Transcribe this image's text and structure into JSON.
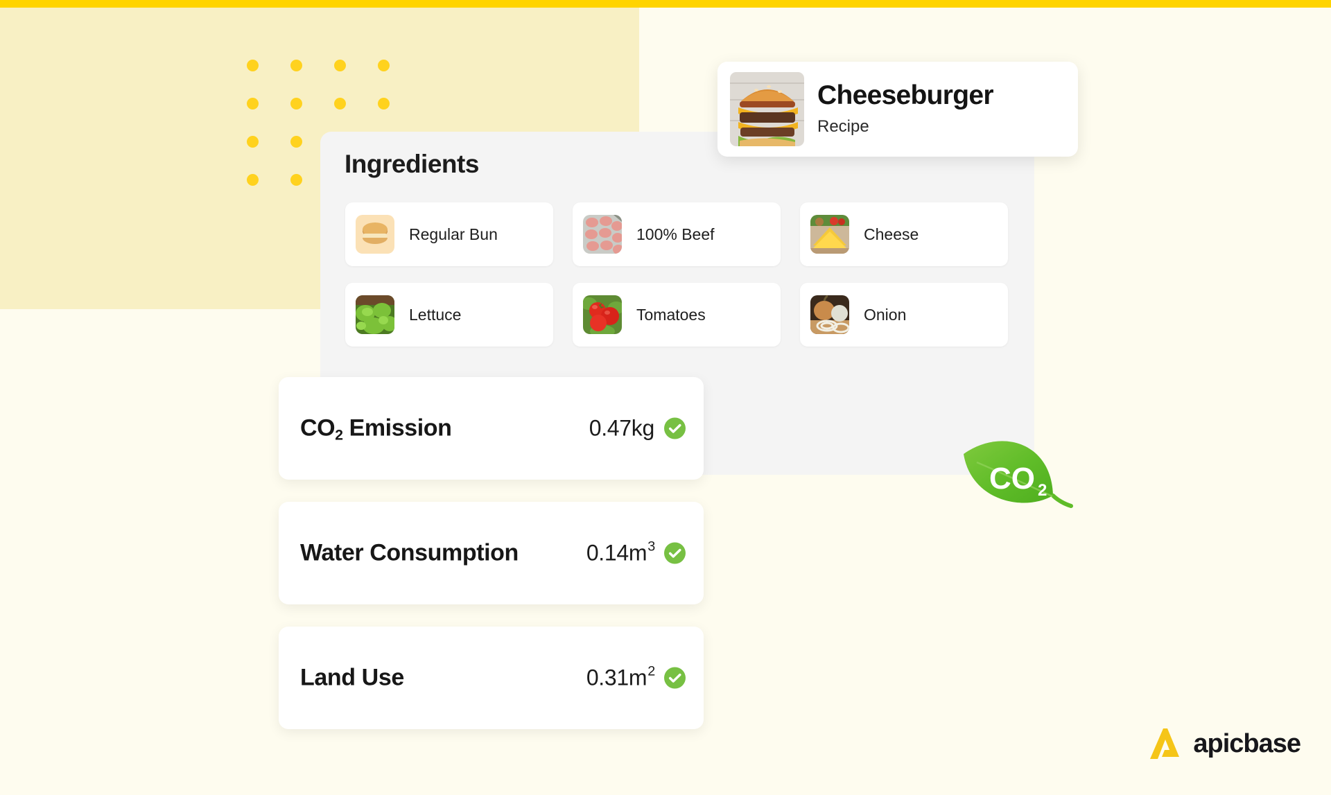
{
  "colors": {
    "top_bar": "#FFD400",
    "pale_block": "#F8F0C4",
    "page_background": "#FEFCEF",
    "dot": "#FFD21E",
    "panel": "#F4F4F4",
    "card": "#FFFFFF",
    "check_green": "#77C043",
    "leaf_green": "#63BC2B",
    "brand_yellow": "#F5C518",
    "text_dark": "#171717"
  },
  "recipe_card": {
    "title": "Cheeseburger",
    "subtitle": "Recipe",
    "thumbnail_icon": "cheeseburger-photo"
  },
  "ingredients_panel": {
    "title": "Ingredients",
    "items": [
      {
        "label": "Regular Bun",
        "thumbnail_icon": "bun-photo"
      },
      {
        "label": "100% Beef",
        "thumbnail_icon": "beef-patties-photo"
      },
      {
        "label": "Cheese",
        "thumbnail_icon": "cheese-slices-photo"
      },
      {
        "label": "Lettuce",
        "thumbnail_icon": "lettuce-photo"
      },
      {
        "label": "Tomatoes",
        "thumbnail_icon": "tomatoes-photo"
      },
      {
        "label": "Onion",
        "thumbnail_icon": "onion-photo"
      }
    ]
  },
  "metrics": [
    {
      "label_main": "CO",
      "label_sub": "2",
      "label_rest": " Emission",
      "value": "0.47kg",
      "value_exponent": "",
      "status_icon": "check-circle-icon"
    },
    {
      "label_main": "Water Consumption",
      "label_sub": "",
      "label_rest": "",
      "value": "0.14m",
      "value_exponent": "3",
      "status_icon": "check-circle-icon"
    },
    {
      "label_main": "Land Use",
      "label_sub": "",
      "label_rest": "",
      "value": "0.31m",
      "value_exponent": "2",
      "status_icon": "check-circle-icon"
    }
  ],
  "leaf_badge": {
    "text_main": "CO",
    "text_sub": "2",
    "icon": "co2-leaf-icon"
  },
  "brand": {
    "name": "apicbase",
    "mark_icon": "apicbase-a-logo"
  },
  "decoration": {
    "dot_grid_columns": 4,
    "dot_grid_rows": 4
  }
}
